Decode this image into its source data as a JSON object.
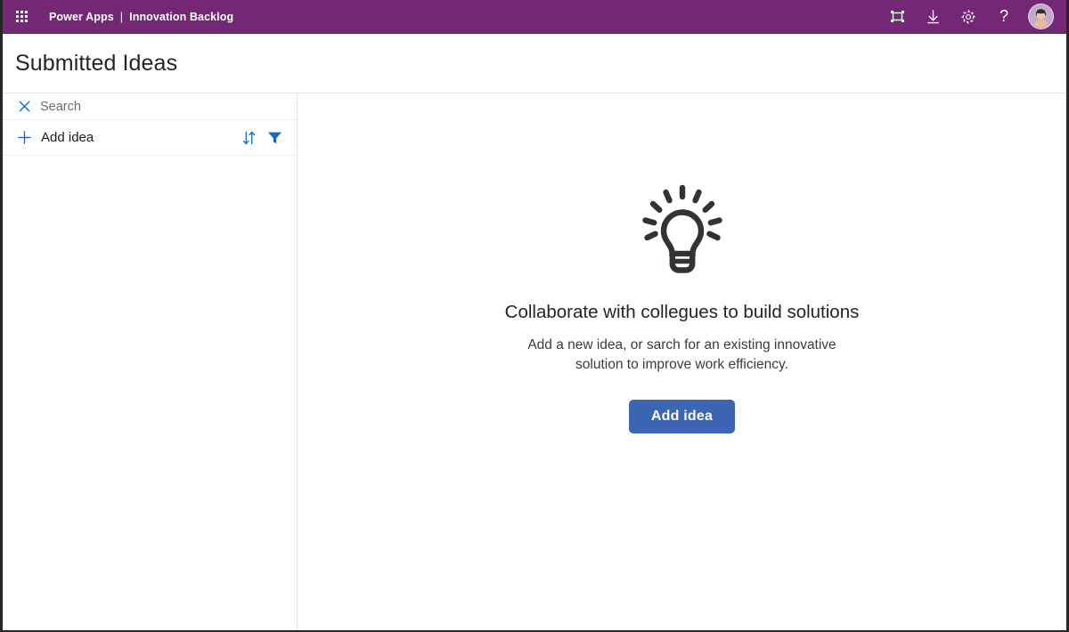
{
  "topbar": {
    "waffle_name": "app-launcher-icon",
    "product": "Power Apps",
    "separator": "|",
    "app_name": "Innovation Backlog",
    "bg_color": "#742774",
    "icons": [
      {
        "name": "fit-to-screen-icon",
        "label": "Fit to screen"
      },
      {
        "name": "download-icon",
        "label": "Download"
      },
      {
        "name": "gear-icon",
        "label": "Settings"
      },
      {
        "name": "help-icon",
        "label": "?"
      }
    ],
    "avatar_label": "Account manager"
  },
  "page": {
    "title": "Submitted Ideas"
  },
  "sidebar": {
    "search": {
      "clear_icon": "close-icon",
      "placeholder": "Search",
      "value": ""
    },
    "add": {
      "plus_icon": "plus-icon",
      "label": "Add idea"
    },
    "sort_icon": "sort-icon",
    "filter_icon": "filter-icon",
    "items": []
  },
  "empty_state": {
    "illustration": "lightbulb-icon",
    "title": "Collaborate with collegues to build solutions",
    "subtitle": "Add a new idea, or sarch for an existing innovative solution to improve work efficiency.",
    "button_label": "Add idea",
    "button_color": "#3c66b3"
  }
}
